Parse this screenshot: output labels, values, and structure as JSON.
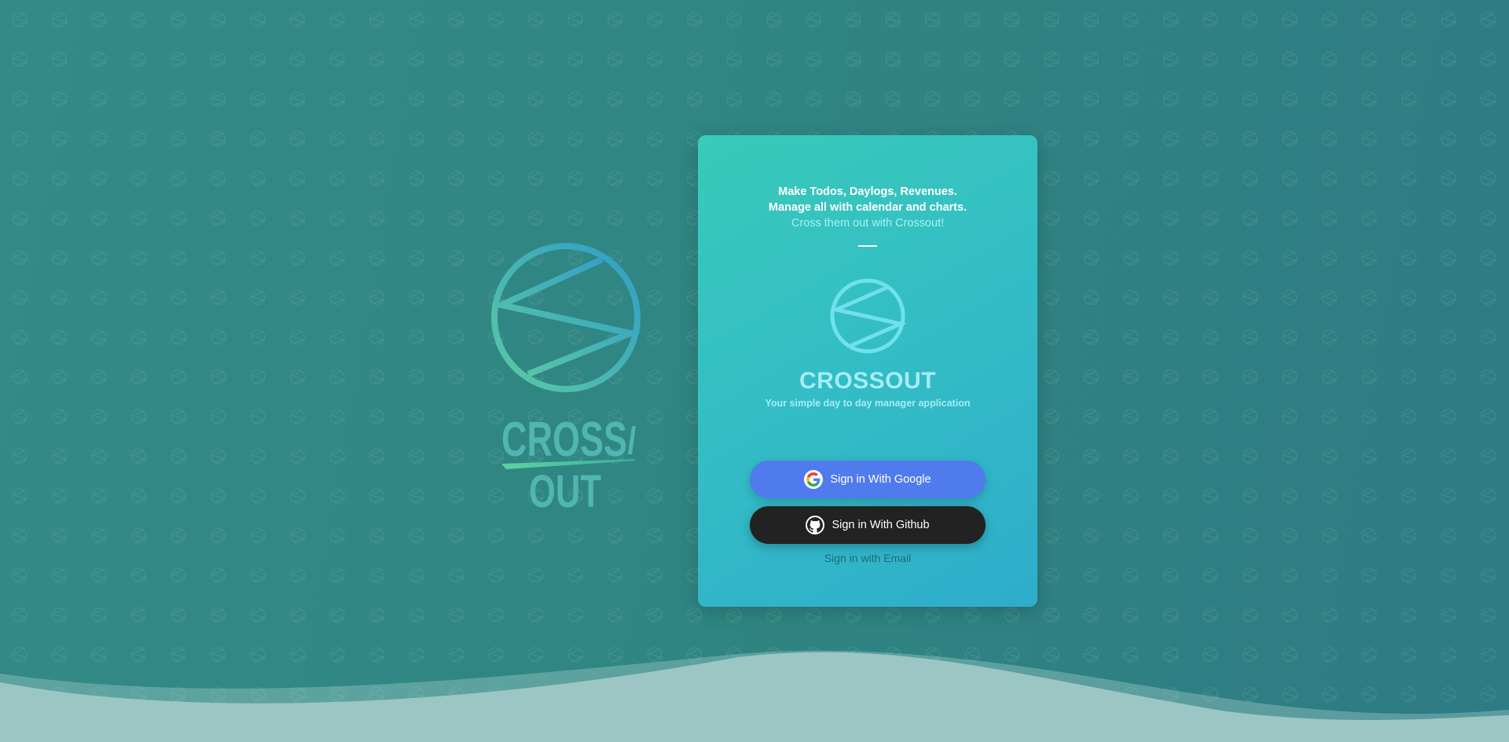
{
  "brand": {
    "logo_wordmark_top": "CROSS",
    "logo_wordmark_bottom": "OUT",
    "logo_icon": "crossout-logo-icon"
  },
  "card": {
    "tagline": [
      "Make Todos, Daylogs, Revenues.",
      "Manage all with calendar and charts.",
      "Cross them out with Crossout!"
    ],
    "app_name": "CROSSOUT",
    "app_subtitle": "Your simple day to day manager application",
    "google_button": {
      "label": "Sign in With Google",
      "icon": "google-icon"
    },
    "github_button": {
      "label": "Sign in With Github",
      "icon": "github-icon"
    },
    "email_link": "Sign in with Email"
  },
  "colors": {
    "background": "#2f8582",
    "card_gradient_start": "#39cab8",
    "card_gradient_end": "#2eadcb",
    "google_button": "#4f7bec",
    "github_button": "#222222",
    "wave": "#9cc6c4"
  }
}
